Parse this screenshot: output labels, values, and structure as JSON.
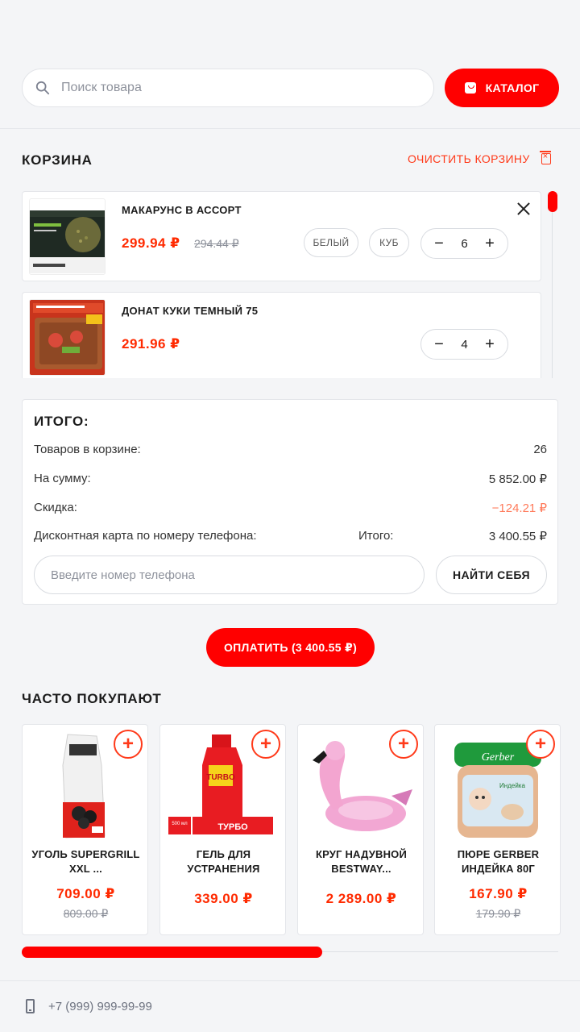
{
  "search": {
    "placeholder": "Поиск товара"
  },
  "catalog_button": "КАТАЛОГ",
  "cart": {
    "title": "КОРЗИНА",
    "clear_label": "ОЧИСТИТЬ КОРЗИНУ",
    "items": [
      {
        "name": "МАКАРУНС В АССОРТ",
        "price": "299.94 ₽",
        "old_price": "294.44 ₽",
        "options": [
          "БЕЛЫЙ",
          "КУБ"
        ],
        "quantity": "6"
      },
      {
        "name": "ДОНАТ КУКИ ТЕМНЫЙ 75",
        "price": "291.96 ₽",
        "quantity": "4"
      }
    ]
  },
  "summary": {
    "title": "ИТОГО:",
    "items_label": "Товаров в корзине:",
    "items_value": "26",
    "sum_label": "На сумму:",
    "sum_value": "5 852.00 ₽",
    "discount_label": "Скидка:",
    "discount_value": "−124.21 ₽",
    "card_label": "Дисконтная карта по номеру телефона:",
    "total_label": "Итого:",
    "total_value": "3 400.55 ₽",
    "phone_placeholder": "Введите номер телефона",
    "find_button": "НАЙТИ СЕБЯ"
  },
  "pay_button": "ОПЛАТИТЬ  (3 400.55 ₽)",
  "recommended": {
    "title": "ЧАСТО ПОКУПАЮТ",
    "items": [
      {
        "name": "УГОЛЬ SUPERGRILL XXL ...",
        "price": "709.00 ₽",
        "old_price": "809.00 ₽"
      },
      {
        "name": "ГЕЛЬ ДЛЯ УСТРАНЕНИЯ",
        "price": "339.00 ₽",
        "image_text": "TURBO",
        "image_badge": "ТУРБО",
        "image_volume": "500 мл"
      },
      {
        "name": "КРУГ НАДУВНОЙ BESTWAY...",
        "price": "2 289.00 ₽"
      },
      {
        "name": "ПЮРЕ GERBER ИНДЕЙКА 80Г",
        "price": "167.90 ₽",
        "old_price": "179.90 ₽",
        "image_brand": "Gerber",
        "image_label": "Индейка"
      }
    ],
    "scroll_progress": 0.56
  },
  "footer": {
    "phone": "+7 (999) 999-99-99"
  },
  "colors": {
    "accent": "#ff0000",
    "price": "#ff2a00",
    "discount": "#ff7a5a",
    "muted": "#8c909a"
  },
  "icons": [
    "search-icon",
    "bag-icon",
    "trash-icon",
    "close-icon",
    "plus-icon",
    "minus-icon",
    "phone-icon"
  ]
}
